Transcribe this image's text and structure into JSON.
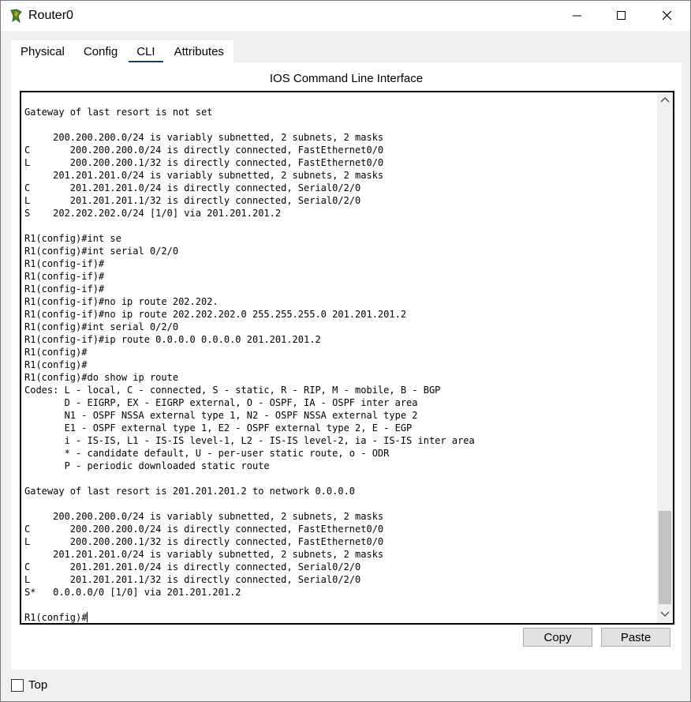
{
  "window": {
    "title": "Router0",
    "controls": {
      "minimize": "minimize",
      "maximize": "maximize",
      "close": "close"
    }
  },
  "tabs": [
    {
      "label": "Physical"
    },
    {
      "label": "Config"
    },
    {
      "label": "CLI",
      "active": true
    },
    {
      "label": "Attributes"
    }
  ],
  "cli": {
    "heading": "IOS Command Line Interface",
    "lines": [
      "Gateway of last resort is not set",
      "",
      "     200.200.200.0/24 is variably subnetted, 2 subnets, 2 masks",
      "C       200.200.200.0/24 is directly connected, FastEthernet0/0",
      "L       200.200.200.1/32 is directly connected, FastEthernet0/0",
      "     201.201.201.0/24 is variably subnetted, 2 subnets, 2 masks",
      "C       201.201.201.0/24 is directly connected, Serial0/2/0",
      "L       201.201.201.1/32 is directly connected, Serial0/2/0",
      "S    202.202.202.0/24 [1/0] via 201.201.201.2",
      "",
      "R1(config)#int se",
      "R1(config)#int serial 0/2/0",
      "R1(config-if)#",
      "R1(config-if)#",
      "R1(config-if)#",
      "R1(config-if)#no ip route 202.202.",
      "R1(config-if)#no ip route 202.202.202.0 255.255.255.0 201.201.201.2",
      "R1(config)#int serial 0/2/0",
      "R1(config-if)#ip route 0.0.0.0 0.0.0.0 201.201.201.2",
      "R1(config)#",
      "R1(config)#",
      "R1(config)#do show ip route",
      "Codes: L - local, C - connected, S - static, R - RIP, M - mobile, B - BGP",
      "       D - EIGRP, EX - EIGRP external, O - OSPF, IA - OSPF inter area",
      "       N1 - OSPF NSSA external type 1, N2 - OSPF NSSA external type 2",
      "       E1 - OSPF external type 1, E2 - OSPF external type 2, E - EGP",
      "       i - IS-IS, L1 - IS-IS level-1, L2 - IS-IS level-2, ia - IS-IS inter area",
      "       * - candidate default, U - per-user static route, o - ODR",
      "       P - periodic downloaded static route",
      "",
      "Gateway of last resort is 201.201.201.2 to network 0.0.0.0",
      "",
      "     200.200.200.0/24 is variably subnetted, 2 subnets, 2 masks",
      "C       200.200.200.0/24 is directly connected, FastEthernet0/0",
      "L       200.200.200.1/32 is directly connected, FastEthernet0/0",
      "     201.201.201.0/24 is variably subnetted, 2 subnets, 2 masks",
      "C       201.201.201.0/24 is directly connected, Serial0/2/0",
      "L       201.201.201.1/32 is directly connected, Serial0/2/0",
      "S*   0.0.0.0/0 [1/0] via 201.201.201.2",
      ""
    ],
    "prompt": "R1(config)#"
  },
  "buttons": {
    "copy": "Copy",
    "paste": "Paste"
  },
  "top_checkbox": {
    "label": "Top",
    "checked": false
  },
  "icons": {
    "app": "router-icon",
    "scroll_up": "chevron-up-icon",
    "scroll_down": "chevron-down-icon"
  }
}
